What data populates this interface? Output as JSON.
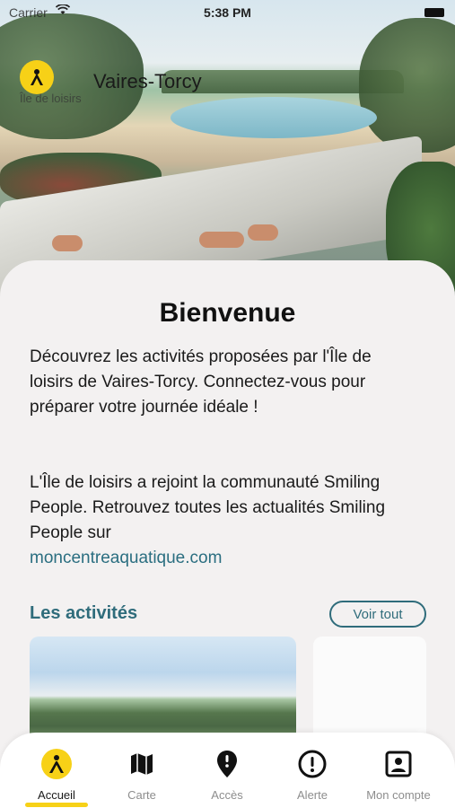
{
  "status": {
    "carrier": "Carrier",
    "time": "5:38 PM"
  },
  "brand": {
    "title": "Vaires-Torcy",
    "subtitle": "Île de loisirs"
  },
  "welcome": {
    "title": "Bienvenue",
    "paragraph1": "Découvrez les activités proposées par l'Île de loisirs de Vaires-Torcy. Connectez-vous pour préparer votre journée idéale !",
    "paragraph2": "L'Île de loisirs a rejoint la communauté Smiling People. Retrouvez toutes les actualités Smiling People sur",
    "link": "moncentreaquatique.com"
  },
  "activities": {
    "title": "Les activités",
    "see_all": "Voir tout"
  },
  "tabs": {
    "home": "Accueil",
    "map": "Carte",
    "access": "Accès",
    "alert": "Alerte",
    "account": "Mon compte"
  },
  "colors": {
    "accent": "#f7d117",
    "teal": "#2f6c7b",
    "inactive": "#8d8d8d"
  }
}
